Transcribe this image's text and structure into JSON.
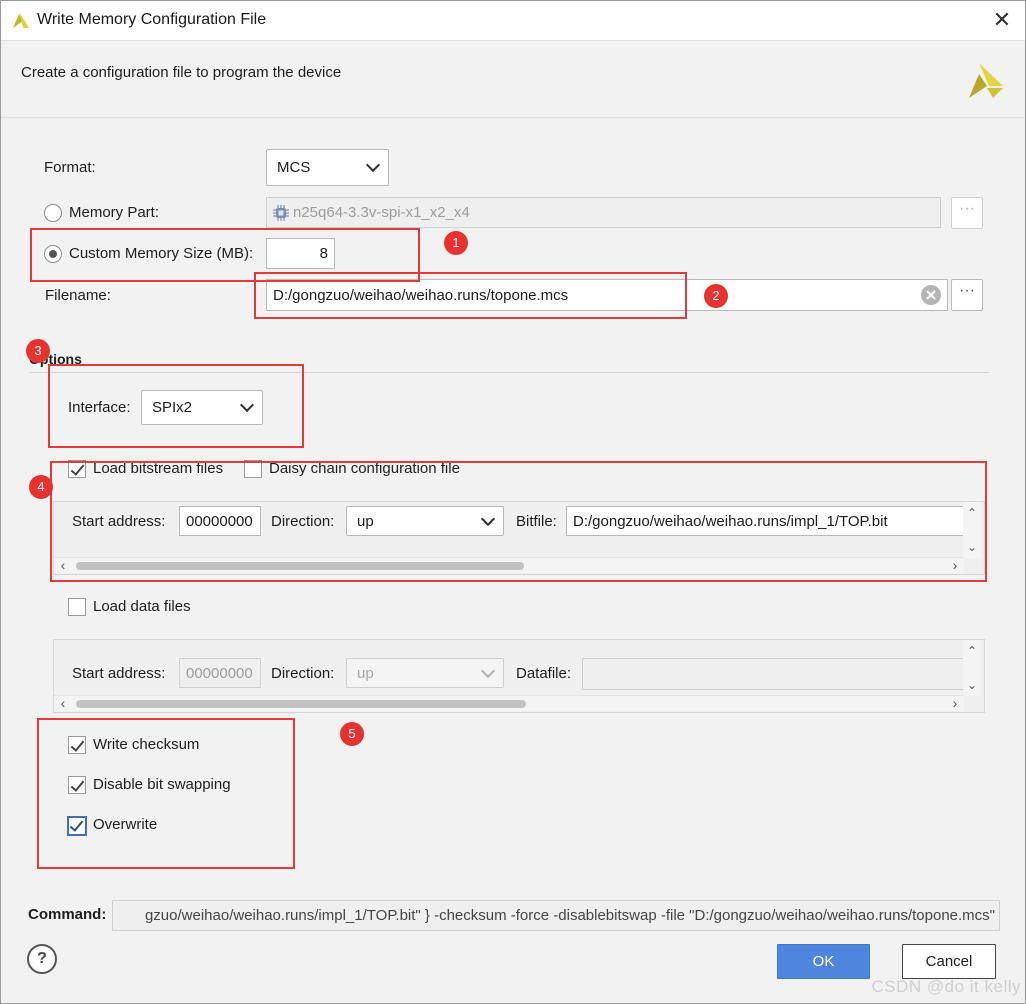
{
  "window": {
    "title": "Write Memory Configuration File",
    "subtitle": "Create a configuration file to program the device"
  },
  "format": {
    "label": "Format:",
    "value": "MCS"
  },
  "memory_part": {
    "label": "Memory Part:",
    "value": "n25q64-3.3v-spi-x1_x2_x4",
    "browse": "···"
  },
  "custom_size": {
    "label": "Custom Memory Size (MB):",
    "value": "8"
  },
  "filename": {
    "label": "Filename:",
    "value": "D:/gongzuo/weihao/weihao.runs/topone.mcs",
    "browse": "···"
  },
  "options": {
    "heading": "Options",
    "interface_label": "Interface:",
    "interface_value": "SPIx2"
  },
  "bitstream": {
    "load_label": "Load bitstream files",
    "daisy_label": "Daisy chain configuration file",
    "start_label": "Start address:",
    "start_value": "00000000",
    "direction_label": "Direction:",
    "direction_value": "up",
    "file_label": "Bitfile:",
    "file_value": "D:/gongzuo/weihao/weihao.runs/impl_1/TOP.bit"
  },
  "datafiles": {
    "load_label": "Load data files",
    "start_label": "Start address:",
    "start_value": "00000000",
    "direction_label": "Direction:",
    "direction_value": "up",
    "file_label": "Datafile:"
  },
  "checks": {
    "checksum": "Write checksum",
    "bitswap": "Disable bit swapping",
    "overwrite": "Overwrite"
  },
  "command": {
    "label": "Command:",
    "value": "gzuo/weihao/weihao.runs/impl_1/TOP.bit\" } -checksum -force -disablebitswap -file \"D:/gongzuo/weihao/weihao.runs/topone.mcs\""
  },
  "buttons": {
    "help": "?",
    "ok": "OK",
    "cancel": "Cancel"
  },
  "badges": [
    "1",
    "2",
    "3",
    "4",
    "5"
  ],
  "watermark": "CSDN @do it kelly",
  "colors": {
    "accent": "#4d86dc",
    "annotation_red": "#e33b3b",
    "badge_red": "#e8322f"
  }
}
